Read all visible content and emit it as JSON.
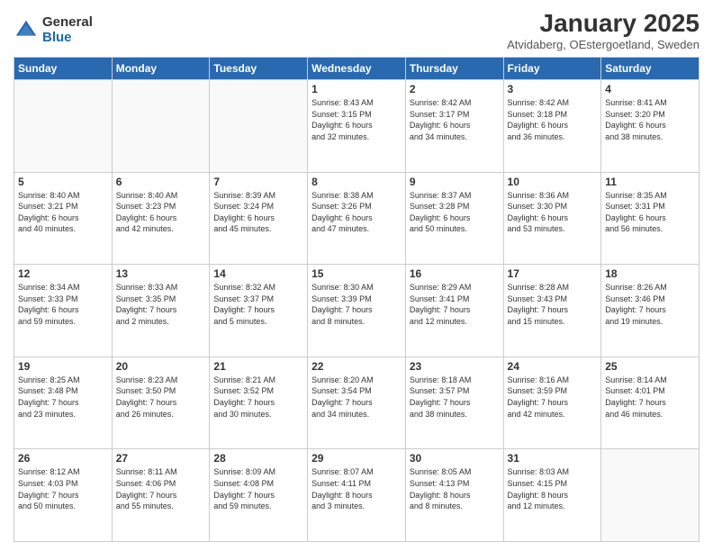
{
  "header": {
    "logo_general": "General",
    "logo_blue": "Blue",
    "title": "January 2025",
    "subtitle": "Atvidaberg, OEstergoetland, Sweden"
  },
  "days_of_week": [
    "Sunday",
    "Monday",
    "Tuesday",
    "Wednesday",
    "Thursday",
    "Friday",
    "Saturday"
  ],
  "weeks": [
    [
      {
        "day": "",
        "info": ""
      },
      {
        "day": "",
        "info": ""
      },
      {
        "day": "",
        "info": ""
      },
      {
        "day": "1",
        "info": "Sunrise: 8:43 AM\nSunset: 3:15 PM\nDaylight: 6 hours\nand 32 minutes."
      },
      {
        "day": "2",
        "info": "Sunrise: 8:42 AM\nSunset: 3:17 PM\nDaylight: 6 hours\nand 34 minutes."
      },
      {
        "day": "3",
        "info": "Sunrise: 8:42 AM\nSunset: 3:18 PM\nDaylight: 6 hours\nand 36 minutes."
      },
      {
        "day": "4",
        "info": "Sunrise: 8:41 AM\nSunset: 3:20 PM\nDaylight: 6 hours\nand 38 minutes."
      }
    ],
    [
      {
        "day": "5",
        "info": "Sunrise: 8:40 AM\nSunset: 3:21 PM\nDaylight: 6 hours\nand 40 minutes."
      },
      {
        "day": "6",
        "info": "Sunrise: 8:40 AM\nSunset: 3:23 PM\nDaylight: 6 hours\nand 42 minutes."
      },
      {
        "day": "7",
        "info": "Sunrise: 8:39 AM\nSunset: 3:24 PM\nDaylight: 6 hours\nand 45 minutes."
      },
      {
        "day": "8",
        "info": "Sunrise: 8:38 AM\nSunset: 3:26 PM\nDaylight: 6 hours\nand 47 minutes."
      },
      {
        "day": "9",
        "info": "Sunrise: 8:37 AM\nSunset: 3:28 PM\nDaylight: 6 hours\nand 50 minutes."
      },
      {
        "day": "10",
        "info": "Sunrise: 8:36 AM\nSunset: 3:30 PM\nDaylight: 6 hours\nand 53 minutes."
      },
      {
        "day": "11",
        "info": "Sunrise: 8:35 AM\nSunset: 3:31 PM\nDaylight: 6 hours\nand 56 minutes."
      }
    ],
    [
      {
        "day": "12",
        "info": "Sunrise: 8:34 AM\nSunset: 3:33 PM\nDaylight: 6 hours\nand 59 minutes."
      },
      {
        "day": "13",
        "info": "Sunrise: 8:33 AM\nSunset: 3:35 PM\nDaylight: 7 hours\nand 2 minutes."
      },
      {
        "day": "14",
        "info": "Sunrise: 8:32 AM\nSunset: 3:37 PM\nDaylight: 7 hours\nand 5 minutes."
      },
      {
        "day": "15",
        "info": "Sunrise: 8:30 AM\nSunset: 3:39 PM\nDaylight: 7 hours\nand 8 minutes."
      },
      {
        "day": "16",
        "info": "Sunrise: 8:29 AM\nSunset: 3:41 PM\nDaylight: 7 hours\nand 12 minutes."
      },
      {
        "day": "17",
        "info": "Sunrise: 8:28 AM\nSunset: 3:43 PM\nDaylight: 7 hours\nand 15 minutes."
      },
      {
        "day": "18",
        "info": "Sunrise: 8:26 AM\nSunset: 3:46 PM\nDaylight: 7 hours\nand 19 minutes."
      }
    ],
    [
      {
        "day": "19",
        "info": "Sunrise: 8:25 AM\nSunset: 3:48 PM\nDaylight: 7 hours\nand 23 minutes."
      },
      {
        "day": "20",
        "info": "Sunrise: 8:23 AM\nSunset: 3:50 PM\nDaylight: 7 hours\nand 26 minutes."
      },
      {
        "day": "21",
        "info": "Sunrise: 8:21 AM\nSunset: 3:52 PM\nDaylight: 7 hours\nand 30 minutes."
      },
      {
        "day": "22",
        "info": "Sunrise: 8:20 AM\nSunset: 3:54 PM\nDaylight: 7 hours\nand 34 minutes."
      },
      {
        "day": "23",
        "info": "Sunrise: 8:18 AM\nSunset: 3:57 PM\nDaylight: 7 hours\nand 38 minutes."
      },
      {
        "day": "24",
        "info": "Sunrise: 8:16 AM\nSunset: 3:59 PM\nDaylight: 7 hours\nand 42 minutes."
      },
      {
        "day": "25",
        "info": "Sunrise: 8:14 AM\nSunset: 4:01 PM\nDaylight: 7 hours\nand 46 minutes."
      }
    ],
    [
      {
        "day": "26",
        "info": "Sunrise: 8:12 AM\nSunset: 4:03 PM\nDaylight: 7 hours\nand 50 minutes."
      },
      {
        "day": "27",
        "info": "Sunrise: 8:11 AM\nSunset: 4:06 PM\nDaylight: 7 hours\nand 55 minutes."
      },
      {
        "day": "28",
        "info": "Sunrise: 8:09 AM\nSunset: 4:08 PM\nDaylight: 7 hours\nand 59 minutes."
      },
      {
        "day": "29",
        "info": "Sunrise: 8:07 AM\nSunset: 4:11 PM\nDaylight: 8 hours\nand 3 minutes."
      },
      {
        "day": "30",
        "info": "Sunrise: 8:05 AM\nSunset: 4:13 PM\nDaylight: 8 hours\nand 8 minutes."
      },
      {
        "day": "31",
        "info": "Sunrise: 8:03 AM\nSunset: 4:15 PM\nDaylight: 8 hours\nand 12 minutes."
      },
      {
        "day": "",
        "info": ""
      }
    ]
  ]
}
